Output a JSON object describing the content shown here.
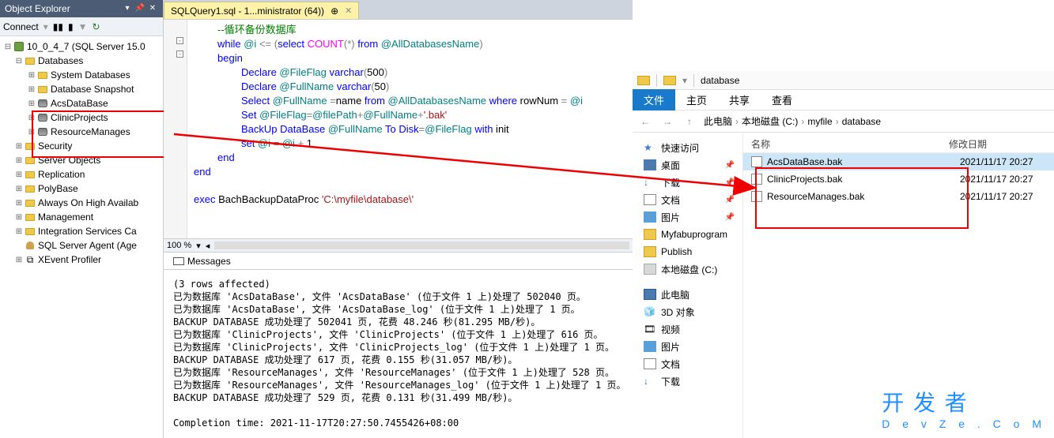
{
  "object_explorer": {
    "title": "Object Explorer",
    "connect_label": "Connect",
    "server": "10_0_4_7 (SQL Server 15.0",
    "nodes": {
      "databases": "Databases",
      "system_db": "System Databases",
      "db_snapshot": "Database Snapshot",
      "acs": "AcsDataBase",
      "clinic": "ClinicProjects",
      "resource": "ResourceManages",
      "security": "Security",
      "server_objects": "Server Objects",
      "replication": "Replication",
      "polybase": "PolyBase",
      "always_on": "Always On High Availab",
      "management": "Management",
      "integration": "Integration Services Ca",
      "sql_agent": "SQL Server Agent (Age",
      "xevent": "XEvent Profiler"
    }
  },
  "editor": {
    "tab_title": "SQLQuery1.sql - 1...ministrator (64))",
    "zoom": "100 %",
    "code": {
      "l1": "--循环备份数据库",
      "l2a": "while",
      "l2b": " @i ",
      "l2c": "<=",
      "l2d": " (",
      "l2e": "select",
      "l2f": " COUNT",
      "l2g": "(*)",
      "l2h": " from",
      "l2i": " @AllDatabasesName",
      "l2j": ")",
      "l3": "begin",
      "l4a": "Declare",
      "l4b": " @FileFlag ",
      "l4c": "varchar",
      "l4d": "(",
      "l4e": "500",
      "l4f": ")",
      "l5a": "Declare",
      "l5b": " @FullName ",
      "l5c": "varchar",
      "l5d": "(",
      "l5e": "50",
      "l5f": ")",
      "l6a": "Select",
      "l6b": " @FullName ",
      "l6c": "=",
      "l6d": "name ",
      "l6e": "from",
      "l6f": " @AllDatabasesName ",
      "l6g": "where",
      "l6h": " rowNum ",
      "l6i": "=",
      "l6j": " @i",
      "l7a": "Set",
      "l7b": " @FileFlag",
      "l7c": "=",
      "l7d": "@filePath",
      "l7e": "+",
      "l7f": "@FullName",
      "l7g": "+",
      "l7h": "'.bak'",
      "l8a": "BackUp",
      "l8b": " DataBase",
      "l8c": " @FullName ",
      "l8d": "To",
      "l8e": " Disk",
      "l8f": "=",
      "l8g": "@FileFlag ",
      "l8h": "with",
      "l8i": " init",
      "l9a": "set",
      "l9b": " @i ",
      "l9c": "=",
      "l9d": " @i ",
      "l9e": "+",
      "l9f": " 1",
      "l10": "end",
      "l11": "end",
      "l13a": "exec",
      "l13b": " BachBackupDataProc ",
      "l13c": "'C:\\myfile\\database\\'"
    }
  },
  "messages": {
    "tab_label": "Messages",
    "body": "(3 rows affected)\n已为数据库 'AcsDataBase', 文件 'AcsDataBase' (位于文件 1 上)处理了 502040 页。\n已为数据库 'AcsDataBase', 文件 'AcsDataBase_log' (位于文件 1 上)处理了 1 页。\nBACKUP DATABASE 成功处理了 502041 页, 花费 48.246 秒(81.295 MB/秒)。\n已为数据库 'ClinicProjects', 文件 'ClinicProjects' (位于文件 1 上)处理了 616 页。\n已为数据库 'ClinicProjects', 文件 'ClinicProjects_log' (位于文件 1 上)处理了 1 页。\nBACKUP DATABASE 成功处理了 617 页, 花费 0.155 秒(31.057 MB/秒)。\n已为数据库 'ResourceManages', 文件 'ResourceManages' (位于文件 1 上)处理了 528 页。\n已为数据库 'ResourceManages', 文件 'ResourceManages_log' (位于文件 1 上)处理了 1 页。\nBACKUP DATABASE 成功处理了 529 页, 花费 0.131 秒(31.499 MB/秒)。\n\nCompletion time: 2021-11-17T20:27:50.7455426+08:00"
  },
  "file_explorer": {
    "title_path": "database",
    "ribbon": {
      "file": "文件",
      "home": "主页",
      "share": "共享",
      "view": "查看"
    },
    "crumbs": {
      "pc": "此电脑",
      "disk": "本地磁盘 (C:)",
      "myfile": "myfile",
      "database": "database"
    },
    "nav": {
      "quick": "快速访问",
      "desktop": "桌面",
      "downloads": "下载",
      "documents": "文档",
      "pictures": "图片",
      "myfabu": "Myfabuprogram",
      "publish": "Publish",
      "disk_c": "本地磁盘 (C:)",
      "this_pc": "此电脑",
      "threeD": "3D 对象",
      "video": "视频",
      "pics2": "图片",
      "docs2": "文档",
      "down2": "下载"
    },
    "columns": {
      "name": "名称",
      "modified": "修改日期"
    },
    "files": [
      {
        "name": "AcsDataBase.bak",
        "date": "2021/11/17 20:27"
      },
      {
        "name": "ClinicProjects.bak",
        "date": "2021/11/17 20:27"
      },
      {
        "name": "ResourceManages.bak",
        "date": "2021/11/17 20:27"
      }
    ]
  },
  "watermark": {
    "main": "开 发 者",
    "sub": "D e v Z e . C o M"
  }
}
